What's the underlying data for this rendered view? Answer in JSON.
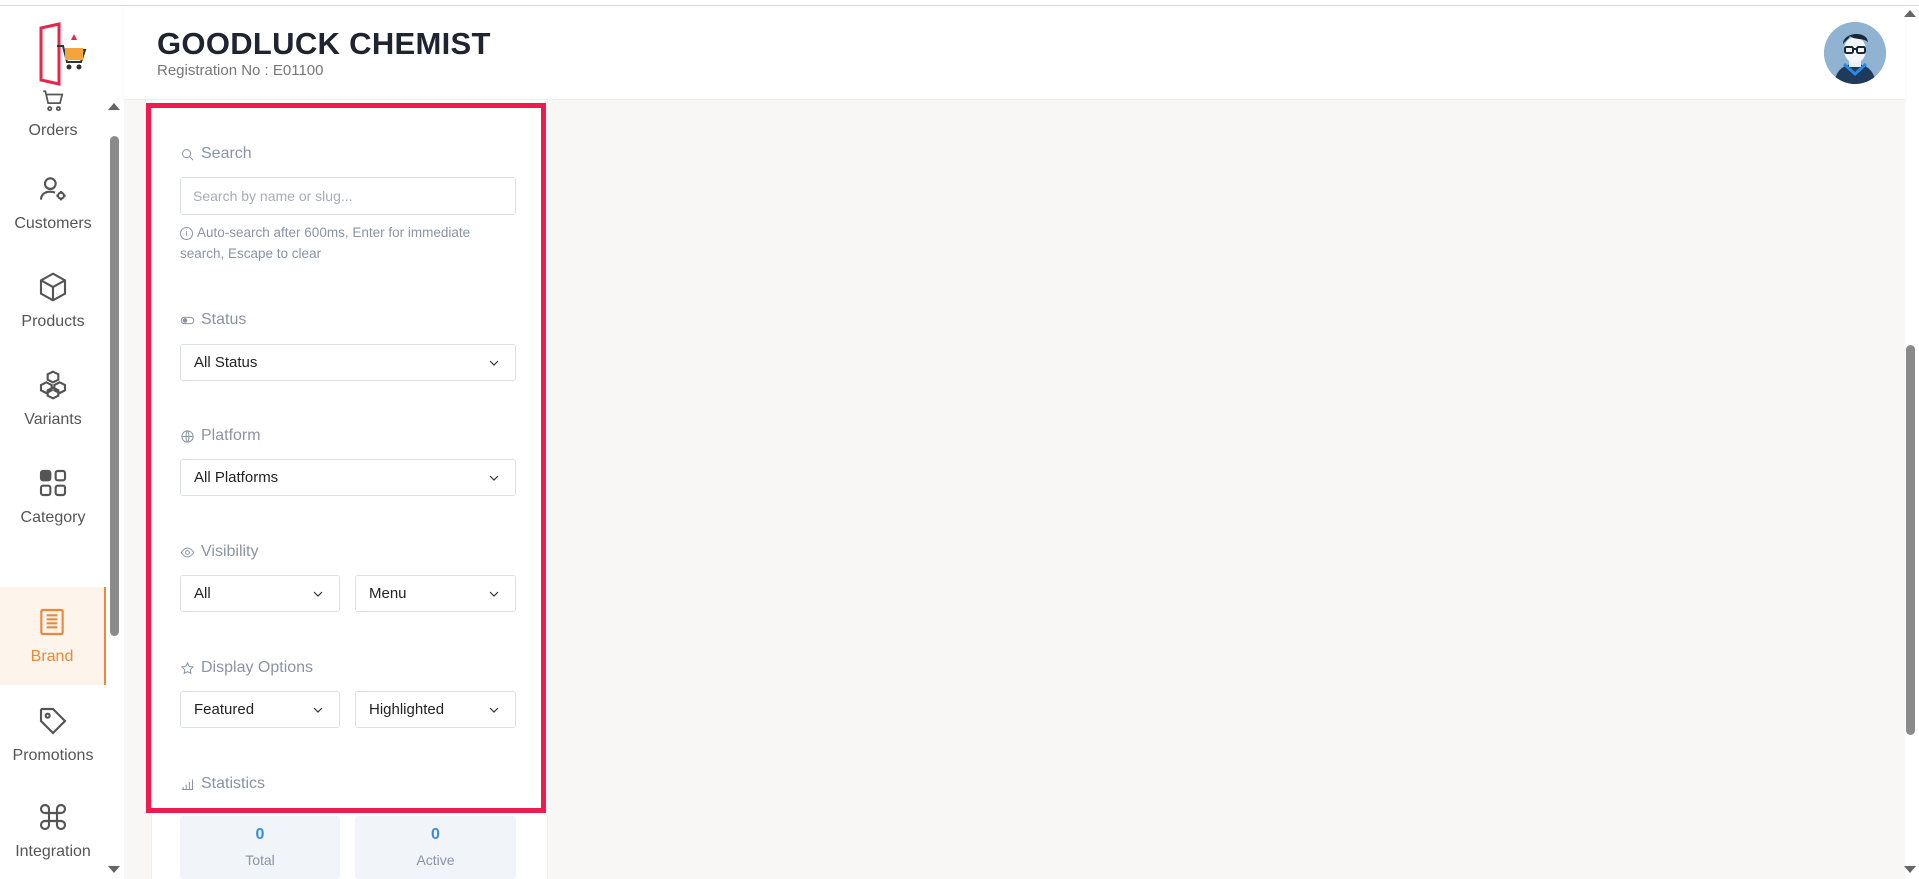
{
  "colors": {
    "accent": "#e8893c",
    "highlight": "#ee1c4e",
    "stat_value": "#3a8ed8"
  },
  "header": {
    "title": "GOODLUCK CHEMIST",
    "registration": "Registration No : E01100"
  },
  "sidebar": {
    "items": [
      {
        "label": "Orders",
        "icon": "cart-icon",
        "active": false
      },
      {
        "label": "Customers",
        "icon": "user-settings-icon",
        "active": false
      },
      {
        "label": "Products",
        "icon": "box-icon",
        "active": false
      },
      {
        "label": "Variants",
        "icon": "boxes-icon",
        "active": false
      },
      {
        "label": "Category",
        "icon": "grid-icon",
        "active": false
      },
      {
        "label": "Brand",
        "icon": "brand-icon",
        "active": true
      },
      {
        "label": "Promotions",
        "icon": "tag-icon",
        "active": false
      },
      {
        "label": "Integration",
        "icon": "command-icon",
        "active": false
      }
    ]
  },
  "filters": {
    "search": {
      "label": "Search",
      "placeholder": "Search by name or slug...",
      "value": "",
      "hint": "Auto-search after 600ms, Enter for immediate search, Escape to clear"
    },
    "status": {
      "label": "Status",
      "selected": "All Status"
    },
    "platform": {
      "label": "Platform",
      "selected": "All Platforms"
    },
    "visibility": {
      "label": "Visibility",
      "selected_1": "All",
      "selected_2": "Menu"
    },
    "display_options": {
      "label": "Display Options",
      "selected_1": "Featured",
      "selected_2": "Highlighted"
    },
    "statistics": {
      "label": "Statistics",
      "total_value": "0",
      "total_label": "Total",
      "active_value": "0",
      "active_label": "Active"
    }
  }
}
